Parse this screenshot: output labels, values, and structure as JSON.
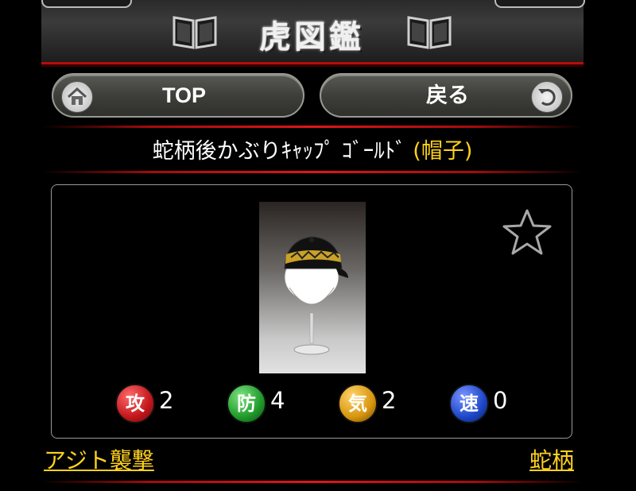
{
  "header": {
    "title": "虎図鑑"
  },
  "nav": {
    "top_label": "TOP",
    "back_label": "戻る"
  },
  "item": {
    "name": "蛇柄後かぶりｷｬｯﾌﾟ ｺﾞｰﾙﾄﾞ",
    "category": "(帽子)",
    "favorite": false
  },
  "stats": [
    {
      "label": "攻",
      "value": "2",
      "color": "#c2161b"
    },
    {
      "label": "防",
      "value": "4",
      "color": "#1f9a2a"
    },
    {
      "label": "気",
      "value": "2",
      "color": "#d6950d"
    },
    {
      "label": "速",
      "value": "0",
      "color": "#1d46c9"
    }
  ],
  "footer": {
    "left_link": "アジト襲撃",
    "right_link": "蛇柄"
  },
  "colors": {
    "accent_red": "#e0161a",
    "link_yellow": "#ffd21e"
  }
}
